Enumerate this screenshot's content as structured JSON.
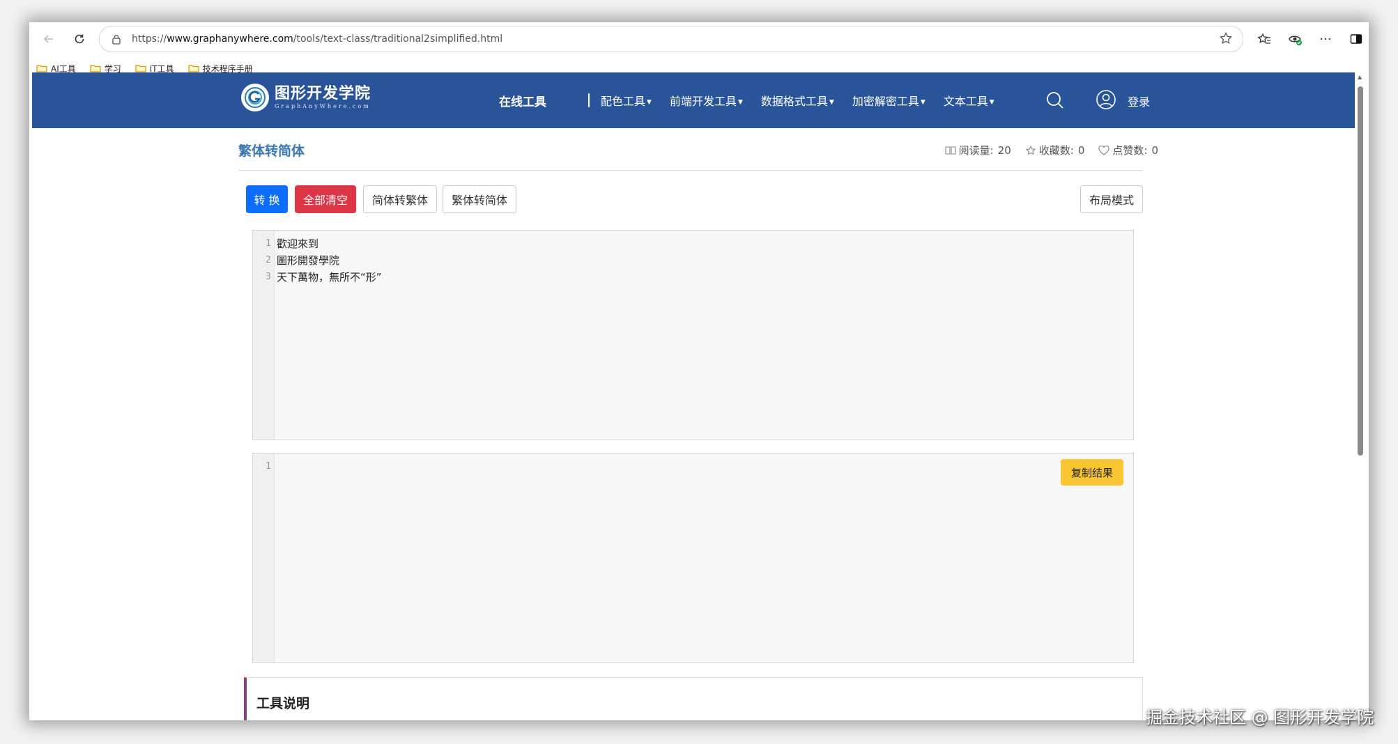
{
  "browser": {
    "url_prefix": "https://",
    "url_domain": "www.graphanywhere.com",
    "url_path": "/tools/text-class/traditional2simplified.html",
    "bookmarks": [
      {
        "label": "AI工具"
      },
      {
        "label": "学习"
      },
      {
        "label": "IT工具"
      },
      {
        "label": "技术程序手册"
      }
    ],
    "more_label": "···"
  },
  "header": {
    "logo_title": "图形开发学院",
    "logo_subtitle": "GraphAnyWhere.com",
    "online_tools": "在线工具",
    "menu": [
      {
        "label": "配色工具"
      },
      {
        "label": "前端开发工具"
      },
      {
        "label": "数据格式工具"
      },
      {
        "label": "加密解密工具"
      },
      {
        "label": "文本工具"
      }
    ],
    "login": "登录"
  },
  "page": {
    "title": "繁体转简体",
    "stats": {
      "views_label": "阅读量:",
      "views": "20",
      "favorites_label": "收藏数:",
      "favorites": "0",
      "likes_label": "点赞数:",
      "likes": "0"
    },
    "buttons": {
      "convert": "转 换",
      "clear_all": "全部清空",
      "simp_to_trad": "简体转繁体",
      "trad_to_simp": "繁体转简体",
      "layout_mode": "布局模式"
    },
    "input_lines": [
      {
        "no": "1",
        "text": "歡迎來到"
      },
      {
        "no": "2",
        "text": "圖形開發學院"
      },
      {
        "no": "3",
        "text": "天下萬物，無所不“形”"
      }
    ],
    "output_lines": [
      {
        "no": "1",
        "text": ""
      }
    ],
    "copy_result": "复制结果",
    "description_title": "工具说明"
  },
  "watermark": "掘金技术社区 @ 图形开发学院",
  "colors": {
    "header_bg": "#2a5499",
    "title": "#3a78b0",
    "primary": "#0d6efd",
    "danger": "#dc3545",
    "warning": "#f8c533",
    "accent_border": "#8a3f80"
  }
}
